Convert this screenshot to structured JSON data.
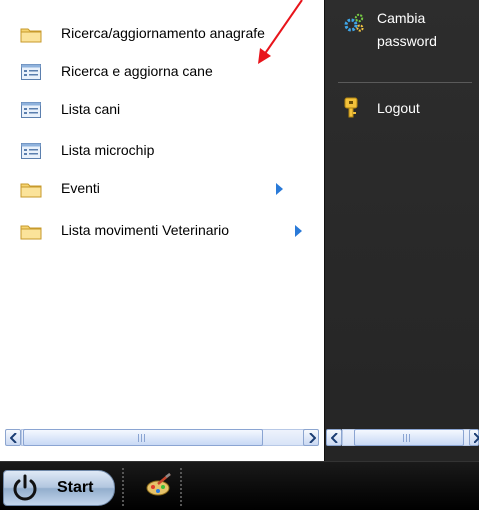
{
  "menu": {
    "items": [
      {
        "label": "Ricerca/aggiornamento anagrafe",
        "icon": "folder-icon",
        "submenu": false
      },
      {
        "label": "Ricerca e aggiorna cane",
        "icon": "list-form-icon",
        "submenu": false
      },
      {
        "label": "Lista cani",
        "icon": "list-form-icon",
        "submenu": false
      },
      {
        "label": "Lista microchip",
        "icon": "list-form-icon",
        "submenu": false
      },
      {
        "label": "Eventi",
        "icon": "folder-icon",
        "submenu": true
      },
      {
        "label": "Lista movimenti Veterinario",
        "icon": "folder-icon",
        "submenu": true
      }
    ]
  },
  "right_panel": {
    "change_password": {
      "line1": "Cambia",
      "line2": "password",
      "icon": "gear-icon"
    },
    "logout": {
      "label": "Logout",
      "icon": "key-icon"
    }
  },
  "scrollbars": {
    "thumb_glyph": "III"
  },
  "taskbar": {
    "start_label": "Start",
    "quicklaunch_icon": "paint-icon"
  },
  "colors": {
    "annotation_arrow": "#e8141b",
    "submenu_arrow": "#2a7ad8",
    "right_panel_bg": "#2a2a2a"
  }
}
